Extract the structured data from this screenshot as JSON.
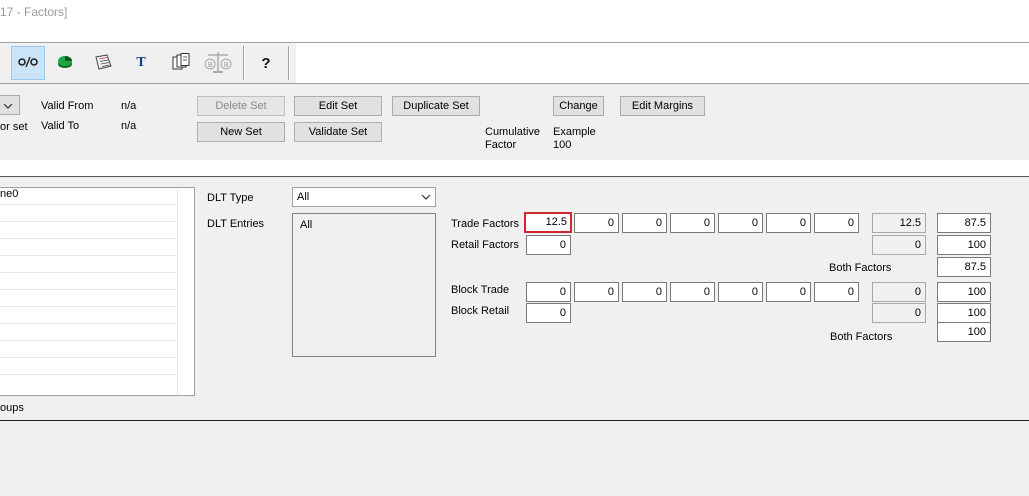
{
  "window": {
    "title_fragment": "17 - Factors]"
  },
  "toolbar": {
    "buttons": [
      {
        "name": "percent-toggle-button",
        "glyph": "⁰⁄₀",
        "active": true
      },
      {
        "name": "pie-chart-button",
        "glyph": "",
        "active": false
      },
      {
        "name": "ledger-button",
        "glyph": "",
        "active": false
      },
      {
        "name": "text-button",
        "glyph": "T",
        "active": false
      },
      {
        "name": "documents-button",
        "glyph": "",
        "active": false
      },
      {
        "name": "balance-scale-button",
        "glyph": "",
        "active": false
      },
      {
        "name": "help-button",
        "glyph": "?",
        "active": false
      }
    ]
  },
  "header": {
    "factor_set_label_fragment": "or set",
    "valid_from_label": "Valid From",
    "valid_from_value": "n/a",
    "valid_to_label": "Valid To",
    "valid_to_value": "n/a",
    "delete_set": "Delete Set",
    "edit_set": "Edit Set",
    "duplicate_set": "Duplicate Set",
    "new_set": "New Set",
    "validate_set": "Validate Set",
    "change": "Change",
    "edit_margins": "Edit Margins",
    "cumulative_factor_line1": "Cumulative",
    "cumulative_factor_line2": "Factor",
    "example_label": "Example",
    "example_value": "100"
  },
  "left_list": {
    "header_fragment": "ne0",
    "footer_fragment": "oups"
  },
  "dlt": {
    "type_label": "DLT Type",
    "type_value": "All",
    "entries_label": "DLT Entries",
    "entries": [
      "All"
    ]
  },
  "factors": {
    "trade_label": "Trade Factors",
    "retail_label": "Retail Factors",
    "both_label": "Both Factors",
    "block_trade_label": "Block Trade",
    "block_retail_label": "Block Retail",
    "block_both_label": "Both Factors",
    "trade_values": [
      "12.5",
      "0",
      "0",
      "0",
      "0",
      "0",
      "0"
    ],
    "trade_total": "12.5",
    "trade_result": "87.5",
    "retail_value": "0",
    "retail_total": "0",
    "retail_result": "100",
    "both_result": "87.5",
    "block_trade_values": [
      "0",
      "0",
      "0",
      "0",
      "0",
      "0",
      "0"
    ],
    "block_trade_total": "0",
    "block_trade_result": "100",
    "block_retail_value": "0",
    "block_retail_total": "0",
    "block_retail_result": "100",
    "block_both_result": "100"
  },
  "colors": {
    "highlight": "#d0262d",
    "toolbar_active": "#cce4f7"
  }
}
